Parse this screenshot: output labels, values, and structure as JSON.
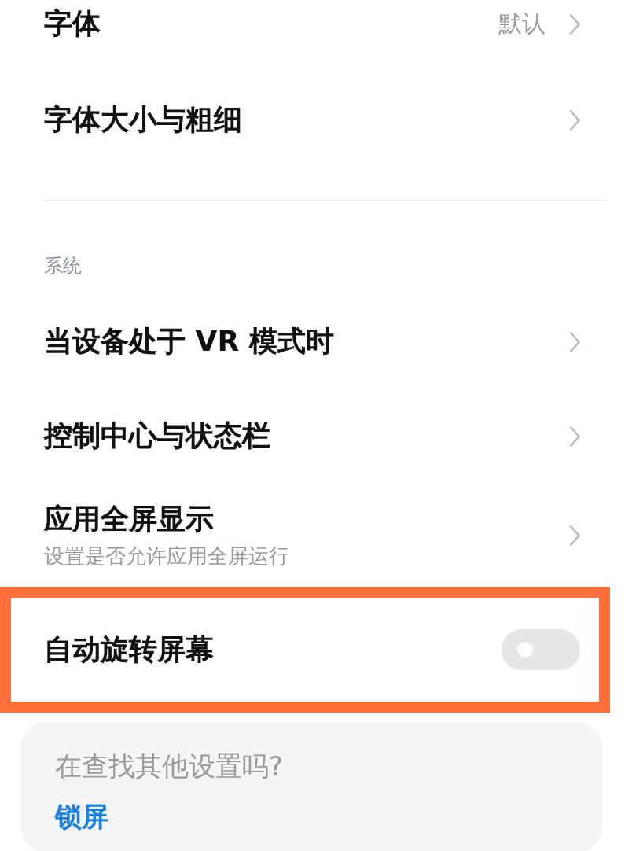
{
  "rows": [
    {
      "kind": "link",
      "title": "字体",
      "value": "默认"
    },
    {
      "kind": "link",
      "title": "字体大小与粗细"
    }
  ],
  "section": {
    "label": "系统",
    "rows": [
      {
        "kind": "link",
        "title": "当设备处于 VR 模式时"
      },
      {
        "kind": "link",
        "title": "控制中心与状态栏"
      },
      {
        "kind": "link",
        "title": "应用全屏显示",
        "subtitle": "设置是否允许应用全屏运行"
      },
      {
        "kind": "toggle",
        "title": "自动旋转屏幕",
        "on": false,
        "highlighted": true
      }
    ]
  },
  "suggest": {
    "question": "在查找其他设置吗?",
    "links": [
      "锁屏"
    ]
  }
}
